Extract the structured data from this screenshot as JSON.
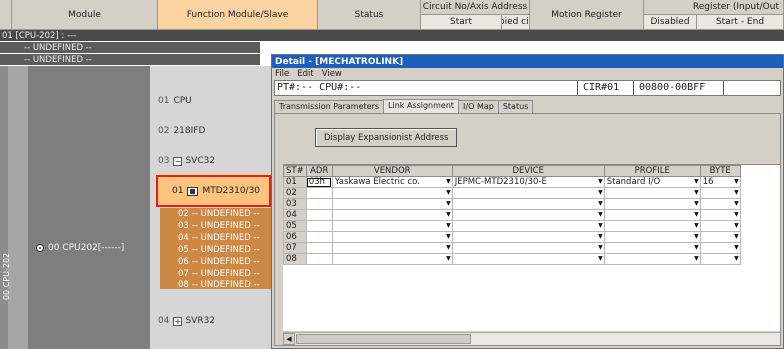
{
  "header": {
    "module": "Module",
    "function_module_slave": "Function Module/Slave",
    "status": "Status",
    "circuit_axis_address": "Circuit No/Axis Address",
    "start": "Start",
    "occupied_circuit": "cupied circu",
    "motion_register": "Motion Register",
    "register_input_output": "Register (Input/Out",
    "disabled": "Disabled",
    "start_end": "Start - End"
  },
  "tree": {
    "row1": "01  [CPU-202] : ---",
    "row2": "-- UNDEFINED --",
    "row3": "-- UNDEFINED --",
    "vertical_label": "00 CPU-202",
    "cpu_node": "00  CPU202[------]",
    "items": [
      {
        "num": "01",
        "label": "CPU"
      },
      {
        "num": "02",
        "label": "218IFD"
      },
      {
        "num": "03",
        "label": "SVC32"
      },
      {
        "num": "04",
        "label": "SVR32"
      }
    ],
    "selected": {
      "num": "01",
      "label": "MTD2310/30"
    },
    "sub_items": [
      {
        "num": "02",
        "label": "-- UNDEFINED --"
      },
      {
        "num": "03",
        "label": "-- UNDEFINED --"
      },
      {
        "num": "04",
        "label": "-- UNDEFINED --"
      },
      {
        "num": "05",
        "label": "-- UNDEFINED --"
      },
      {
        "num": "06",
        "label": "-- UNDEFINED --"
      },
      {
        "num": "07",
        "label": "-- UNDEFINED --"
      },
      {
        "num": "08",
        "label": "-- UNDEFINED --"
      }
    ]
  },
  "window": {
    "title": "Detail - [MECHATROLINK]",
    "menu": [
      "File",
      "Edit",
      "View"
    ],
    "info": {
      "pt": "PT#:-- CPU#:--",
      "cir": "CIR#01",
      "range": "00800-00BFF"
    },
    "tabs": [
      "Transmission Parameters",
      "Link Assignment",
      "I/O Map",
      "Status"
    ],
    "active_tab": 1,
    "button": "Display Expansionist Address",
    "columns": [
      "ST#",
      "ADR",
      "VENDOR",
      "DEVICE",
      "PROFILE",
      "BYTE"
    ],
    "rows": [
      {
        "st": "01",
        "adr": "03h",
        "vendor": "Yaskawa Electric co.",
        "device": "JEPMC-MTD2310/30-E",
        "profile": "Standard I/O",
        "byte": "16"
      },
      {
        "st": "02",
        "adr": "",
        "vendor": "",
        "device": "",
        "profile": "",
        "byte": ""
      },
      {
        "st": "03",
        "adr": "",
        "vendor": "",
        "device": "",
        "profile": "",
        "byte": ""
      },
      {
        "st": "04",
        "adr": "",
        "vendor": "",
        "device": "",
        "profile": "",
        "byte": ""
      },
      {
        "st": "05",
        "adr": "",
        "vendor": "",
        "device": "",
        "profile": "",
        "byte": ""
      },
      {
        "st": "06",
        "adr": "",
        "vendor": "",
        "device": "",
        "profile": "",
        "byte": ""
      },
      {
        "st": "07",
        "adr": "",
        "vendor": "",
        "device": "",
        "profile": "",
        "byte": ""
      },
      {
        "st": "08",
        "adr": "",
        "vendor": "",
        "device": "",
        "profile": "",
        "byte": ""
      }
    ]
  },
  "colors": {
    "highlight_box": "#e0201d",
    "title_bar": "#1d5fbd",
    "function_column": "#fbd3a3"
  }
}
